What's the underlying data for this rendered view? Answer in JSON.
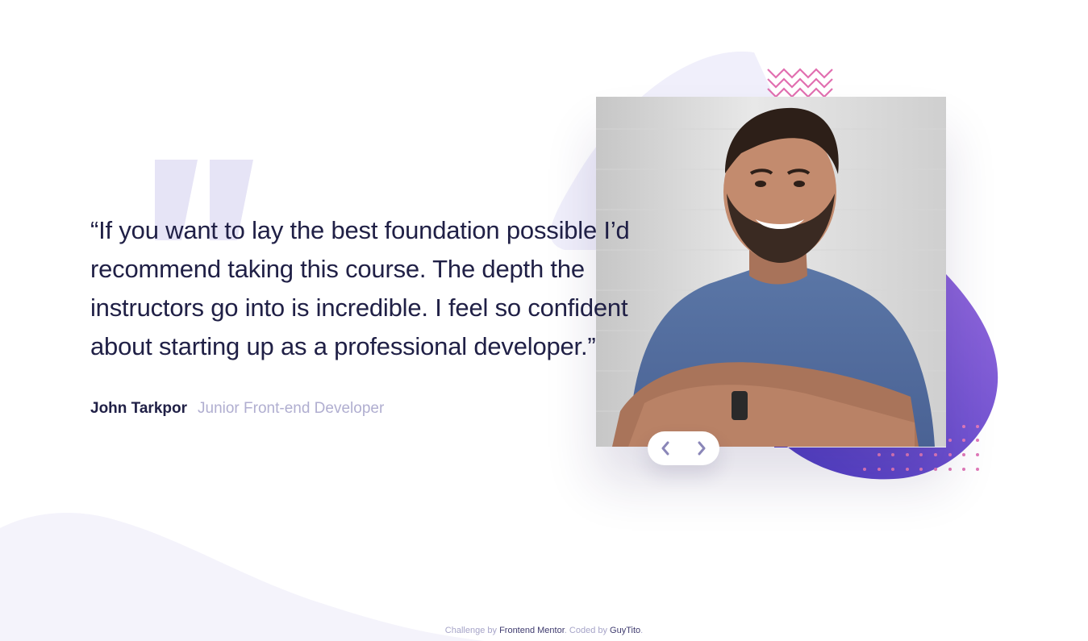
{
  "testimonial": {
    "quote": "“If you want to lay the best foundation possible I’d recommend taking this course. The depth the instructors go into is incredible. I feel so confident about starting up as a professional developer.”",
    "author_name": "John Tarkpor",
    "author_role": "Junior Front-end Developer"
  },
  "photo": {
    "alt": "John Tarkpor"
  },
  "navigation": {
    "prev_icon": "chevron-left-icon",
    "next_icon": "chevron-right-icon"
  },
  "footer": {
    "prefix": "Challenge by",
    "challenge_link": "Frontend Mentor",
    "middle": ". Coded by",
    "coder_link": "GuyTito",
    "suffix": "."
  },
  "colors": {
    "heading": "#202046",
    "role": "#b0aed0",
    "accent_purple": "#6a52d0",
    "quote_mark": "#e6e4f6",
    "curve_bg": "#f4f3fb",
    "dot_pink": "#e079b8"
  }
}
